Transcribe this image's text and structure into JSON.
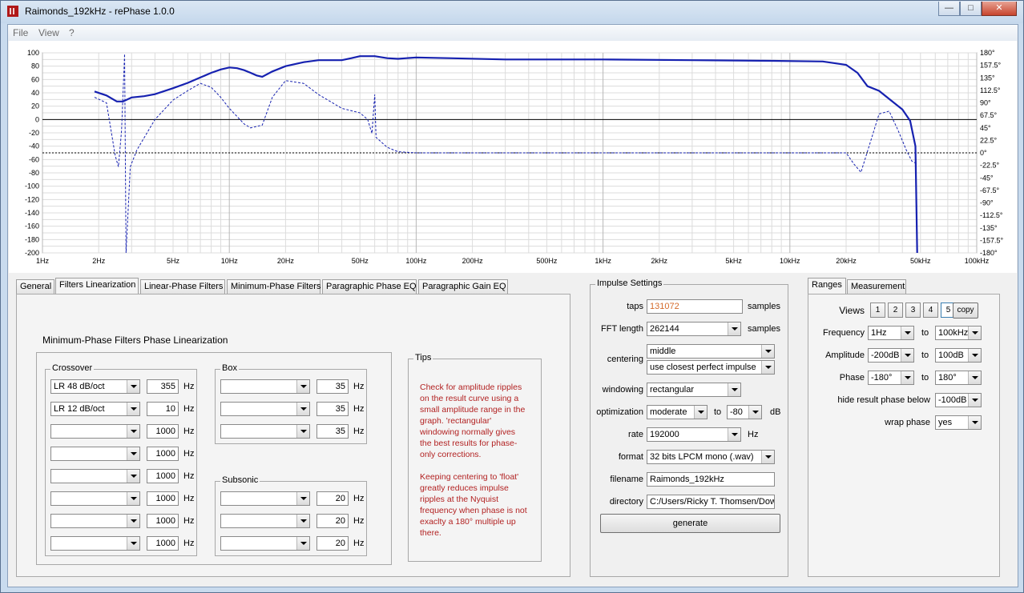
{
  "window": {
    "title": "Raimonds_192kHz  -  rePhase 1.0.0",
    "controls": {
      "minimize": "—",
      "maximize": "□",
      "close": "✕"
    }
  },
  "menu": [
    "File",
    "View",
    "?"
  ],
  "colors": {
    "curve": "#1621b0",
    "zero_line": "#000000",
    "grid": "#dcdcdc",
    "tips_text": "#b22222",
    "taps_value": "#d46a2a"
  },
  "graph": {
    "y_left_ticks": [
      "100",
      "80",
      "60",
      "40",
      "20",
      "0",
      "-20",
      "-40",
      "-60",
      "-80",
      "-100",
      "-120",
      "-140",
      "-160",
      "-180",
      "-200"
    ],
    "y_right_ticks": [
      "180°",
      "157.5°",
      "135°",
      "112.5°",
      "90°",
      "67.5°",
      "45°",
      "22.5°",
      "0°",
      "-22.5°",
      "-45°",
      "-67.5°",
      "-90°",
      "-112.5°",
      "-135°",
      "-157.5°",
      "-180°"
    ],
    "x_ticks": [
      {
        "label": "1Hz",
        "hz": 1
      },
      {
        "label": "2Hz",
        "hz": 2
      },
      {
        "label": "5Hz",
        "hz": 5
      },
      {
        "label": "10Hz",
        "hz": 10
      },
      {
        "label": "20Hz",
        "hz": 20
      },
      {
        "label": "50Hz",
        "hz": 50
      },
      {
        "label": "100Hz",
        "hz": 100
      },
      {
        "label": "200Hz",
        "hz": 200
      },
      {
        "label": "500Hz",
        "hz": 500
      },
      {
        "label": "1kHz",
        "hz": 1000
      },
      {
        "label": "2kHz",
        "hz": 2000
      },
      {
        "label": "5kHz",
        "hz": 5000
      },
      {
        "label": "10kHz",
        "hz": 10000
      },
      {
        "label": "20kHz",
        "hz": 20000
      },
      {
        "label": "50kHz",
        "hz": 50000
      },
      {
        "label": "100kHz",
        "hz": 100000
      }
    ],
    "x_range_hz": [
      1,
      100000
    ],
    "y_range_db": [
      -200,
      100
    ],
    "phase_range_deg": [
      -180,
      180
    ],
    "x_scale": "log",
    "grid": true
  },
  "tabs": [
    "General",
    "Filters Linearization",
    "Linear-Phase Filters",
    "Minimum-Phase Filters",
    "Paragraphic Phase EQ",
    "Paragraphic Gain EQ"
  ],
  "filters": {
    "heading": "Minimum-Phase Filters Phase Linearization",
    "crossover_label": "Crossover",
    "crossover_rows": [
      {
        "type": "LR  48 dB/oct",
        "freq": "355",
        "unit": "Hz"
      },
      {
        "type": "LR  12 dB/oct",
        "freq": "10",
        "unit": "Hz"
      },
      {
        "type": "",
        "freq": "1000",
        "unit": "Hz"
      },
      {
        "type": "",
        "freq": "1000",
        "unit": "Hz"
      },
      {
        "type": "",
        "freq": "1000",
        "unit": "Hz"
      },
      {
        "type": "",
        "freq": "1000",
        "unit": "Hz"
      },
      {
        "type": "",
        "freq": "1000",
        "unit": "Hz"
      },
      {
        "type": "",
        "freq": "1000",
        "unit": "Hz"
      }
    ],
    "box_label": "Box",
    "box_rows": [
      {
        "type": "",
        "freq": "35",
        "unit": "Hz"
      },
      {
        "type": "",
        "freq": "35",
        "unit": "Hz"
      },
      {
        "type": "",
        "freq": "35",
        "unit": "Hz"
      }
    ],
    "subsonic_label": "Subsonic",
    "subsonic_rows": [
      {
        "type": "",
        "freq": "20",
        "unit": "Hz"
      },
      {
        "type": "",
        "freq": "20",
        "unit": "Hz"
      },
      {
        "type": "",
        "freq": "20",
        "unit": "Hz"
      }
    ],
    "tips_label": "Tips",
    "tips_p1": "Check for amplitude ripples on the result curve using a small amplitude range in the graph. 'rectangular' windowing normally gives the best results for phase-only corrections.",
    "tips_p2": "Keeping centering to 'float' greatly reduces impulse ripples at the Nyquist frequency when phase is not exaclty a 180° multiple up there."
  },
  "impulse": {
    "group_label": "Impulse Settings",
    "taps_label": "taps",
    "taps_value": "131072",
    "taps_unit": "samples",
    "fft_label": "FFT length",
    "fft_value": "262144",
    "fft_unit": "samples",
    "centering_label": "centering",
    "centering_value": "middle",
    "centering_value2": "use closest perfect impulse",
    "windowing_label": "windowing",
    "windowing_value": "rectangular",
    "optimization_label": "optimization",
    "optimization_value": "moderate",
    "optimization_to": "to",
    "optimization_db": "-80",
    "optimization_unit": "dB",
    "rate_label": "rate",
    "rate_value": "192000",
    "rate_unit": "Hz",
    "format_label": "format",
    "format_value": "32 bits LPCM mono (.wav)",
    "filename_label": "filename",
    "filename_value": "Raimonds_192kHz",
    "directory_label": "directory",
    "directory_value": "C:/Users/Ricky T. Thomsen/Dow",
    "generate_label": "generate"
  },
  "ranges": {
    "tabs": [
      "Ranges",
      "Measurement"
    ],
    "views_label": "Views",
    "views": [
      "1",
      "2",
      "3",
      "4",
      "5"
    ],
    "views_selected": "5",
    "copy_label": "copy",
    "to": "to",
    "frequency_label": "Frequency",
    "frequency_from": "1Hz",
    "frequency_to": "100kHz",
    "amplitude_label": "Amplitude",
    "amplitude_from": "-200dB",
    "amplitude_to": "100dB",
    "phase_label": "Phase",
    "phase_from": "-180°",
    "phase_to": "180°",
    "hide_label": "hide result phase below",
    "hide_value": "-100dB",
    "wrap_label": "wrap phase",
    "wrap_value": "yes"
  }
}
